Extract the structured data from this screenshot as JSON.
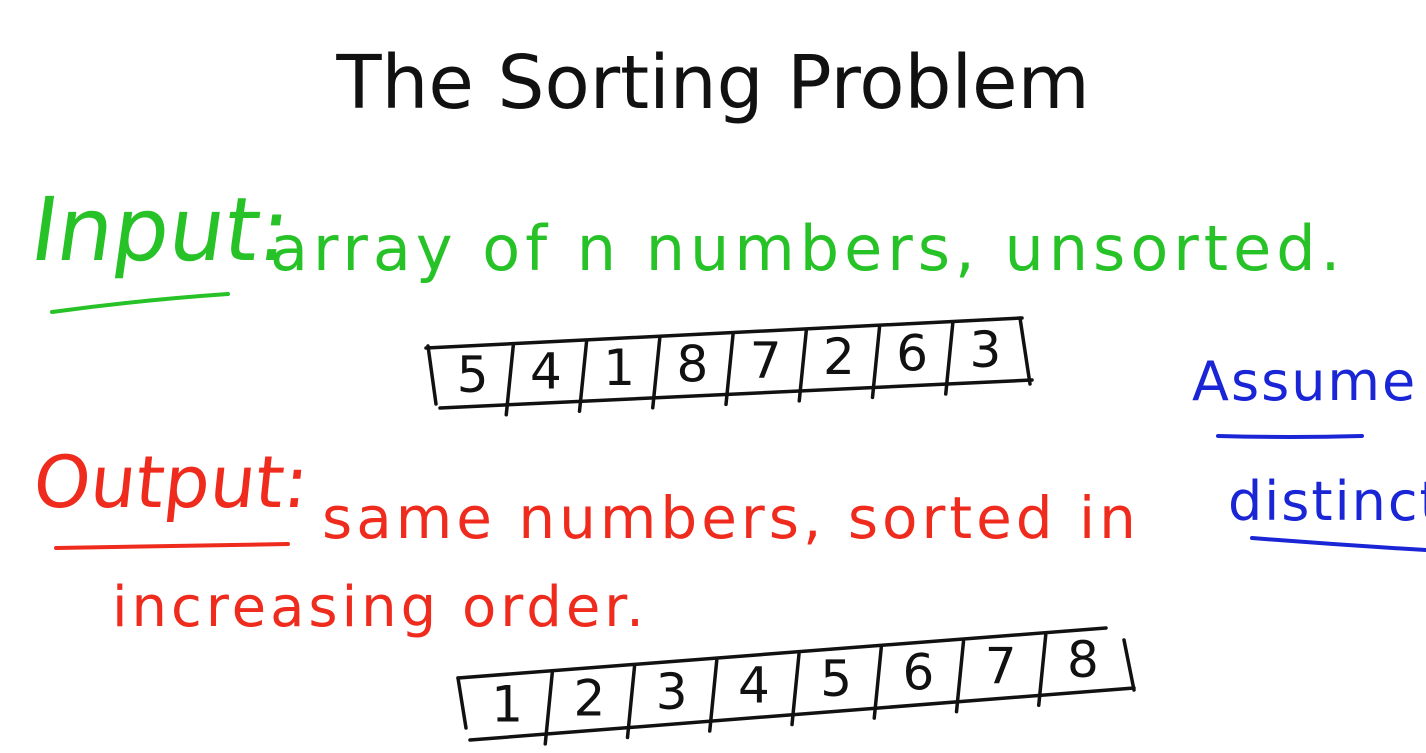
{
  "slide": {
    "title": "The Sorting Problem",
    "input": {
      "label": "Input",
      "separator": ":",
      "text": "array of n numbers, unsorted."
    },
    "input_array": [
      "5",
      "4",
      "1",
      "8",
      "7",
      "2",
      "6",
      "3"
    ],
    "output": {
      "label": "Output",
      "separator": ":",
      "text_line1": "same numbers, sorted in",
      "text_line2": "increasing order."
    },
    "output_array": [
      "1",
      "2",
      "3",
      "4",
      "5",
      "6",
      "7",
      "8"
    ],
    "side_note": {
      "line1": "Assume",
      "line2": "distinct"
    },
    "colors": {
      "input": "#27c227",
      "output": "#ef2b1d",
      "note": "#1a25d6",
      "ink": "#111111"
    }
  }
}
